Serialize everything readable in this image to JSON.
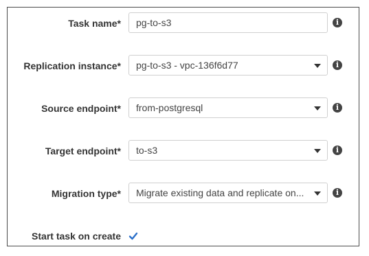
{
  "form": {
    "task_name": {
      "label": "Task name",
      "required": "*",
      "value": "pg-to-s3"
    },
    "replication_instance": {
      "label": "Replication instance",
      "required": "*",
      "value": "pg-to-s3 - vpc-136f6d77"
    },
    "source_endpoint": {
      "label": "Source endpoint",
      "required": "*",
      "value": "from-postgresql"
    },
    "target_endpoint": {
      "label": "Target endpoint",
      "required": "*",
      "value": "to-s3"
    },
    "migration_type": {
      "label": "Migration type",
      "required": "*",
      "value": "Migrate existing data and replicate on..."
    },
    "start_task": {
      "label": "Start task on create",
      "checked": true
    }
  },
  "icons": {
    "info": "info-icon",
    "dropdown": "chevron-down-icon",
    "check": "check-icon"
  },
  "colors": {
    "checkmark": "#2a6fc9",
    "border": "#4a4a4a"
  }
}
